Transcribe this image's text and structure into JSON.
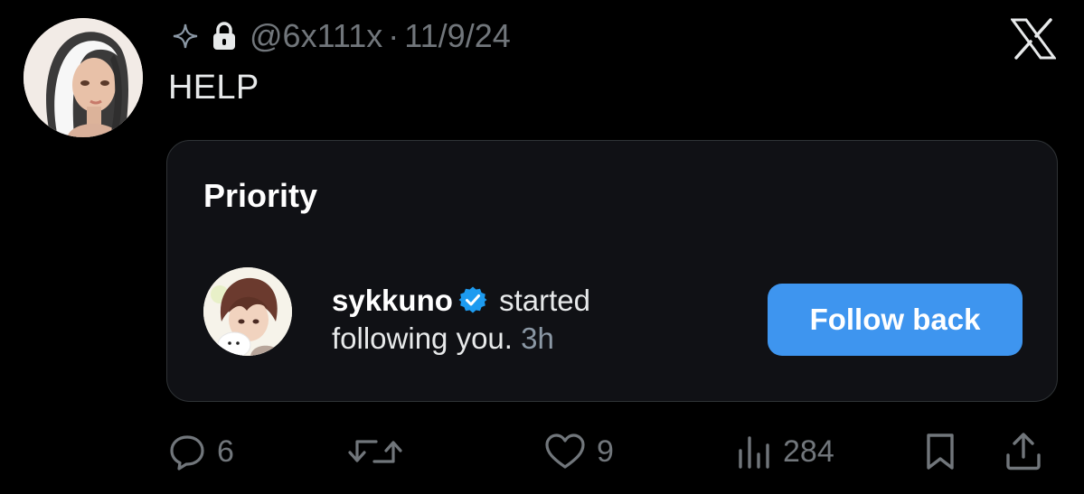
{
  "tweet": {
    "handle": "@6x111x",
    "separator": "·",
    "date": "11/9/24",
    "text": "HELP",
    "header_icons": [
      "sparkle-icon",
      "lock-icon"
    ],
    "brand_icon": "x-logo-icon"
  },
  "card": {
    "title": "Priority",
    "notification": {
      "username": "sykkuno",
      "verified": true,
      "message": "started following you.",
      "time": "3h"
    },
    "follow_button_label": "Follow back"
  },
  "actions": {
    "replies": "6",
    "retweets": "",
    "likes": "9",
    "views": "284"
  },
  "colors": {
    "background": "#000000",
    "card_background": "#101115",
    "primary_text": "#e7e9ea",
    "secondary_text": "#71767b",
    "accent_blue": "#3e95ef",
    "verified_blue": "#1d9bf0"
  }
}
